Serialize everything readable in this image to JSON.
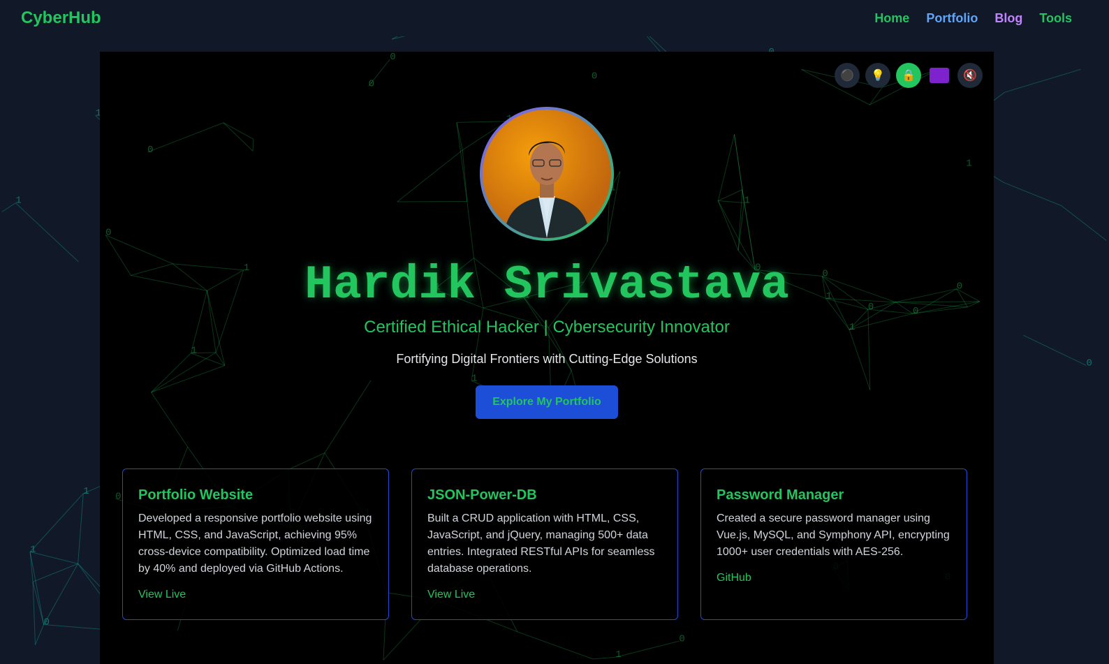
{
  "brand": "CyberHub",
  "nav": [
    {
      "label": "Home",
      "color": "#22c55e"
    },
    {
      "label": "Portfolio",
      "color": "#60a5fa"
    },
    {
      "label": "Blog",
      "color": "#c084fc"
    },
    {
      "label": "Tools",
      "color": "#22c55e"
    }
  ],
  "controls": [
    {
      "icon": "dark-mode-icon",
      "glyph": "⚫"
    },
    {
      "icon": "light-bulb-icon",
      "glyph": "💡"
    },
    {
      "icon": "lock-icon",
      "glyph": "🔒"
    },
    {
      "icon": "purple-theme-icon",
      "glyph": ""
    },
    {
      "icon": "mute-icon",
      "glyph": "🔇"
    }
  ],
  "hero": {
    "name": "Hardik Srivastava",
    "subtitle": "Certified Ethical Hacker | Cybersecurity Innovator",
    "tagline": "Fortifying Digital Frontiers with Cutting-Edge Solutions",
    "cta": "Explore My Portfolio"
  },
  "projects": [
    {
      "title": "Portfolio Website",
      "description": "Developed a responsive portfolio website using HTML, CSS, and JavaScript, achieving 95% cross-device compatibility. Optimized load time by 40% and deployed via GitHub Actions.",
      "link": "View Live"
    },
    {
      "title": "JSON-Power-DB",
      "description": "Built a CRUD application with HTML, CSS, JavaScript, and jQuery, managing 500+ data entries. Integrated RESTful APIs for seamless database operations.",
      "link": "View Live"
    },
    {
      "title": "Password Manager",
      "description": "Created a secure password manager using Vue.js, MySQL, and Symphony API, encrypting 1000+ user credentials with AES-256.",
      "link": "GitHub"
    }
  ],
  "colors": {
    "accent": "#22c55e",
    "button": "#1d4ed8",
    "page_bg": "#111827",
    "panel_bg": "#000000"
  }
}
